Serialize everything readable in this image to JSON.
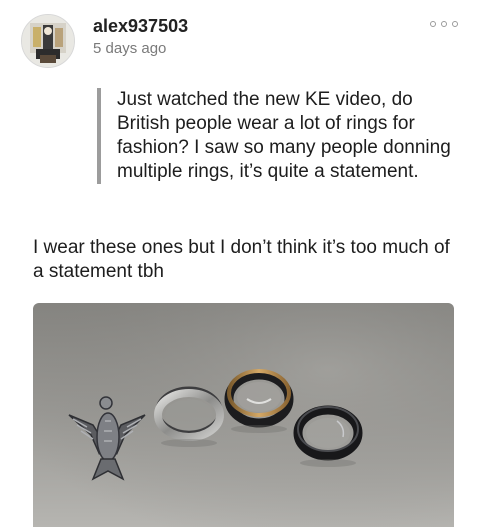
{
  "post": {
    "author": {
      "username": "alex937503",
      "timestamp": "5 days ago",
      "avatar_icon": "profile-photo"
    },
    "more_icon": "more-options-icon",
    "quote": {
      "text": "Just watched the new KE video, do British people wear a lot of rings for fashion? I saw so many people donning multiple rings, it’s quite a statement."
    },
    "body": "I wear these ones but I don’t think it’s too much of a statement tbh",
    "photo": {
      "subject": "four rings on a grey table: an eagle-shaped ring, a silver band, a gold and black band, a black band",
      "colors": {
        "background": "#8f8e8b",
        "silver": "#c9c9c7",
        "gold": "#b8894a",
        "black": "#1c1c1e"
      }
    }
  }
}
